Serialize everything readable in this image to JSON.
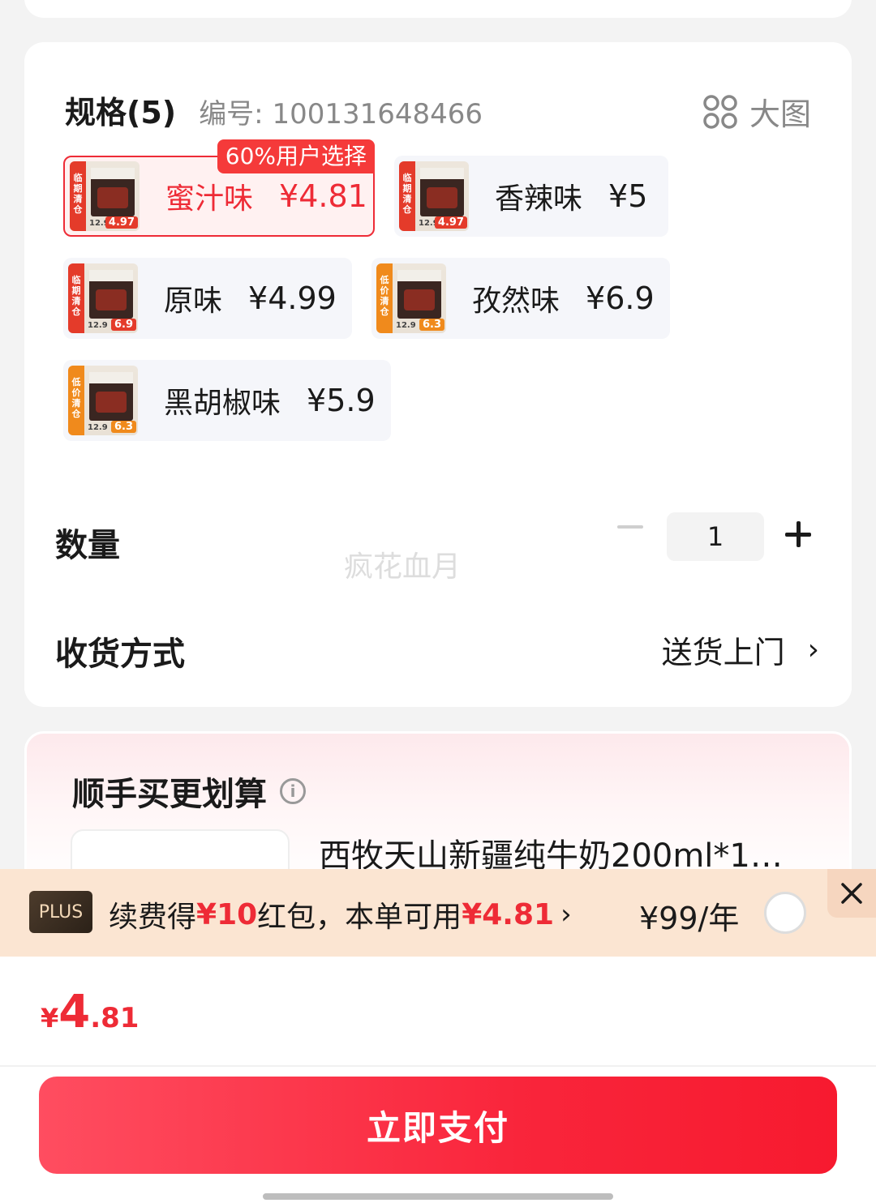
{
  "spec": {
    "title": "规格(5)",
    "code": "编号: 100131648466",
    "big_image_label": "大图",
    "popular_badge": "60%用户选择",
    "items": [
      {
        "label": "蜜汁味",
        "price": "¥4.81",
        "selected": true,
        "thumb_tag": "4.97",
        "thumb_stripe": "临期清仓",
        "thumb_old": "12.9"
      },
      {
        "label": "香辣味",
        "price": "¥5",
        "selected": false,
        "thumb_tag": "4.97",
        "thumb_stripe": "临期清仓",
        "thumb_old": "12.9"
      },
      {
        "label": "原味",
        "price": "¥4.99",
        "selected": false,
        "thumb_tag": "6.9",
        "thumb_stripe": "临期清仓",
        "thumb_old": "12.9"
      },
      {
        "label": "孜然味",
        "price": "¥6.9",
        "selected": false,
        "thumb_tag": "6.3",
        "thumb_stripe": "低价清仓",
        "thumb_old": "12.9"
      },
      {
        "label": "黑胡椒味",
        "price": "¥5.9",
        "selected": false,
        "thumb_tag": "6.3",
        "thumb_stripe": "低价清仓",
        "thumb_old": "12.9"
      }
    ]
  },
  "quantity": {
    "label": "数量",
    "value": "1"
  },
  "watermark": "疯花血月",
  "shipping": {
    "label": "收货方式",
    "value": "送货上门",
    "chevron": "›"
  },
  "deal": {
    "title": "顺手买更划算",
    "info_icon": "i",
    "product_name": "西牧天山新疆纯牛奶200ml*1…"
  },
  "plus": {
    "badge": "PLUS",
    "text_1": "续费得",
    "text_hl1": "¥10",
    "text_2": "红包，本单可用",
    "text_hl2": "¥4.81",
    "chevron": "›",
    "price": "¥99/年",
    "selected": false
  },
  "total": {
    "currency": "¥",
    "integer": "4",
    "decimal": ".81"
  },
  "pay_button": "立即支付",
  "colors": {
    "accent": "#ee2b36",
    "plus_bg": "#fbe5d2",
    "pay_gradient_start": "#ff4d60",
    "pay_gradient_end": "#f71a2f"
  }
}
